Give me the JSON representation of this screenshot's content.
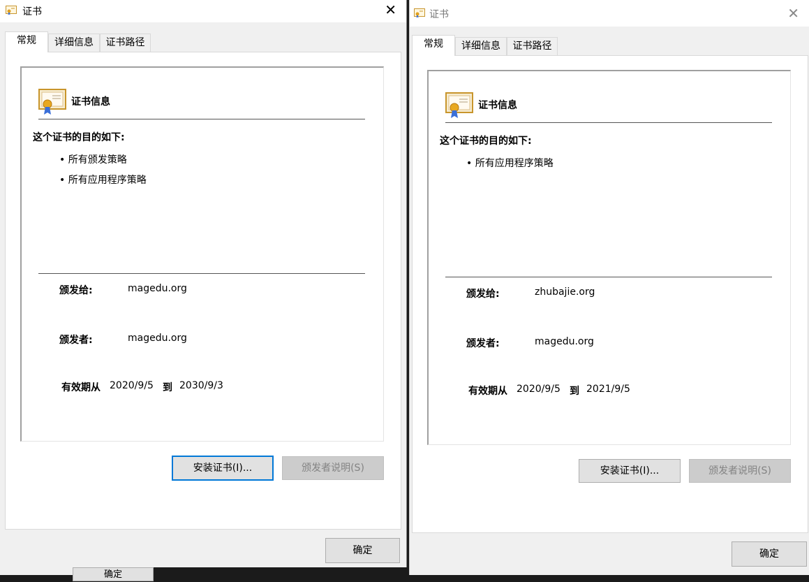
{
  "background_button": {
    "label": "确定"
  },
  "dialogs": [
    {
      "title": "证书",
      "close_glyph": "✕",
      "tabs": [
        "常规",
        "详细信息",
        "证书路径"
      ],
      "header": "证书信息",
      "purpose_heading": "这个证书的目的如下:",
      "purposes": [
        "所有颁发策略",
        "所有应用程序策略"
      ],
      "issued_to_label": "颁发给:",
      "issued_to": "magedu.org",
      "issued_by_label": "颁发者:",
      "issued_by": "magedu.org",
      "valid_label": "有效期从",
      "valid_from": "2020/9/5",
      "to_label": "到",
      "valid_to": "2030/9/3",
      "install_button": "安装证书(I)...",
      "issuer_statement_button": "颁发者说明(S)",
      "ok_button": "确定"
    },
    {
      "title": "证书",
      "close_glyph": "✕",
      "tabs": [
        "常规",
        "详细信息",
        "证书路径"
      ],
      "header": "证书信息",
      "purpose_heading": "这个证书的目的如下:",
      "purposes": [
        "所有应用程序策略"
      ],
      "issued_to_label": "颁发给:",
      "issued_to": "zhubajie.org",
      "issued_by_label": "颁发者:",
      "issued_by": "magedu.org",
      "valid_label": "有效期从",
      "valid_from": "2020/9/5",
      "to_label": "到",
      "valid_to": "2021/9/5",
      "install_button": "安装证书(I)...",
      "issuer_statement_button": "颁发者说明(S)",
      "ok_button": "确定"
    }
  ]
}
